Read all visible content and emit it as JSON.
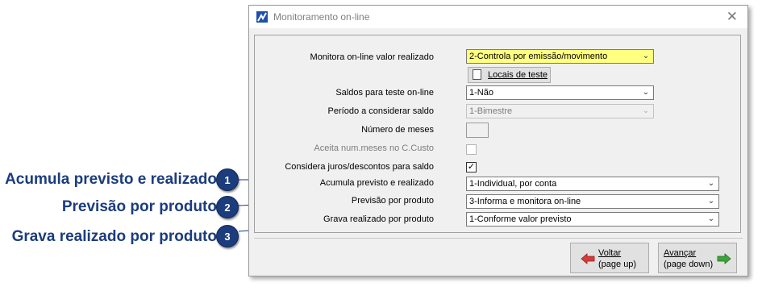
{
  "window": {
    "title": "Monitoramento on-line",
    "close_symbol": "✕"
  },
  "form": {
    "monitora_label": "Monitora on-line valor realizado",
    "monitora_value": "2-Controla por emissão/movimento",
    "locais_button": "Locais de teste",
    "saldos_label": "Saldos para teste on-line",
    "saldos_value": "1-Não",
    "periodo_label": "Período a considerar saldo",
    "periodo_value": "1-Bimestre",
    "numero_label": "Número de meses",
    "aceita_label": "Aceita num.meses no C.Custo",
    "considera_label": "Considera juros/descontos para saldo",
    "considera_checked": "✓",
    "acumula_label": "Acumula previsto e realizado",
    "acumula_value": "1-Individual, por conta",
    "previsao_label": "Previsão por produto",
    "previsao_value": "3-Informa e monitora on-line",
    "grava_label": "Grava realizado por produto",
    "grava_value": "1-Conforme valor previsto"
  },
  "nav": {
    "voltar_1": "Voltar",
    "voltar_2": "(page up)",
    "avancar_1": "Avançar",
    "avancar_2": "(page down)"
  },
  "callouts": [
    {
      "number": "1",
      "text": "Acumula previsto e realizado"
    },
    {
      "number": "2",
      "text": "Previsão por produto"
    },
    {
      "number": "3",
      "text": "Grava realizado por produto"
    }
  ],
  "colors": {
    "callout": "#1b3c7d",
    "highlight_field": "#ffff80",
    "back_arrow": "#d83a3a",
    "forward_arrow": "#3aa63a"
  }
}
